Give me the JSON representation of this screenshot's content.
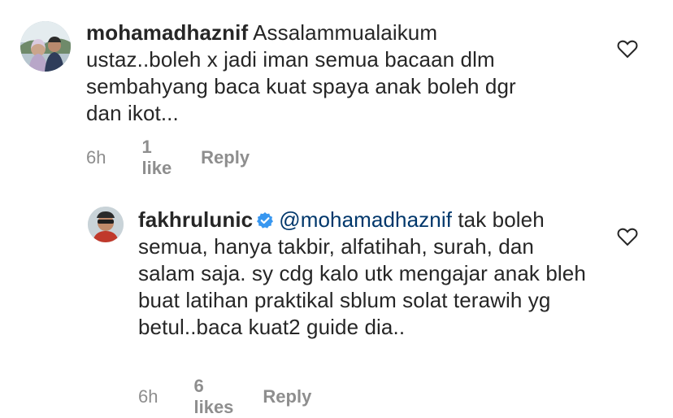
{
  "comments": [
    {
      "username": "mohamadhaznif",
      "text": "Assalammualaikum ustaz..boleh x jadi iman semua bacaan dlm sembahyang baca kuat spaya anak boleh dgr dan ikot...",
      "time": "6h",
      "likes": "1 like",
      "reply": "Reply",
      "liked": false
    },
    {
      "username": "fakhrulunic",
      "verified": true,
      "mention": "@mohamadhaznif",
      "text": "tak boleh semua, hanya takbir, alfatihah, surah, dan salam saja. sy cdg kalo utk mengajar anak bleh buat latihan praktikal sblum solat terawih yg betul..baca kuat2 guide dia..",
      "time": "6h",
      "likes": "6 likes",
      "reply": "Reply",
      "liked": false
    }
  ],
  "colors": {
    "text": "#262626",
    "secondary": "#8e8e8e",
    "mention": "#00376b",
    "verified": "#3897f0"
  },
  "icons": {
    "like": "heart-outline-icon",
    "verified": "verified-badge-icon"
  }
}
